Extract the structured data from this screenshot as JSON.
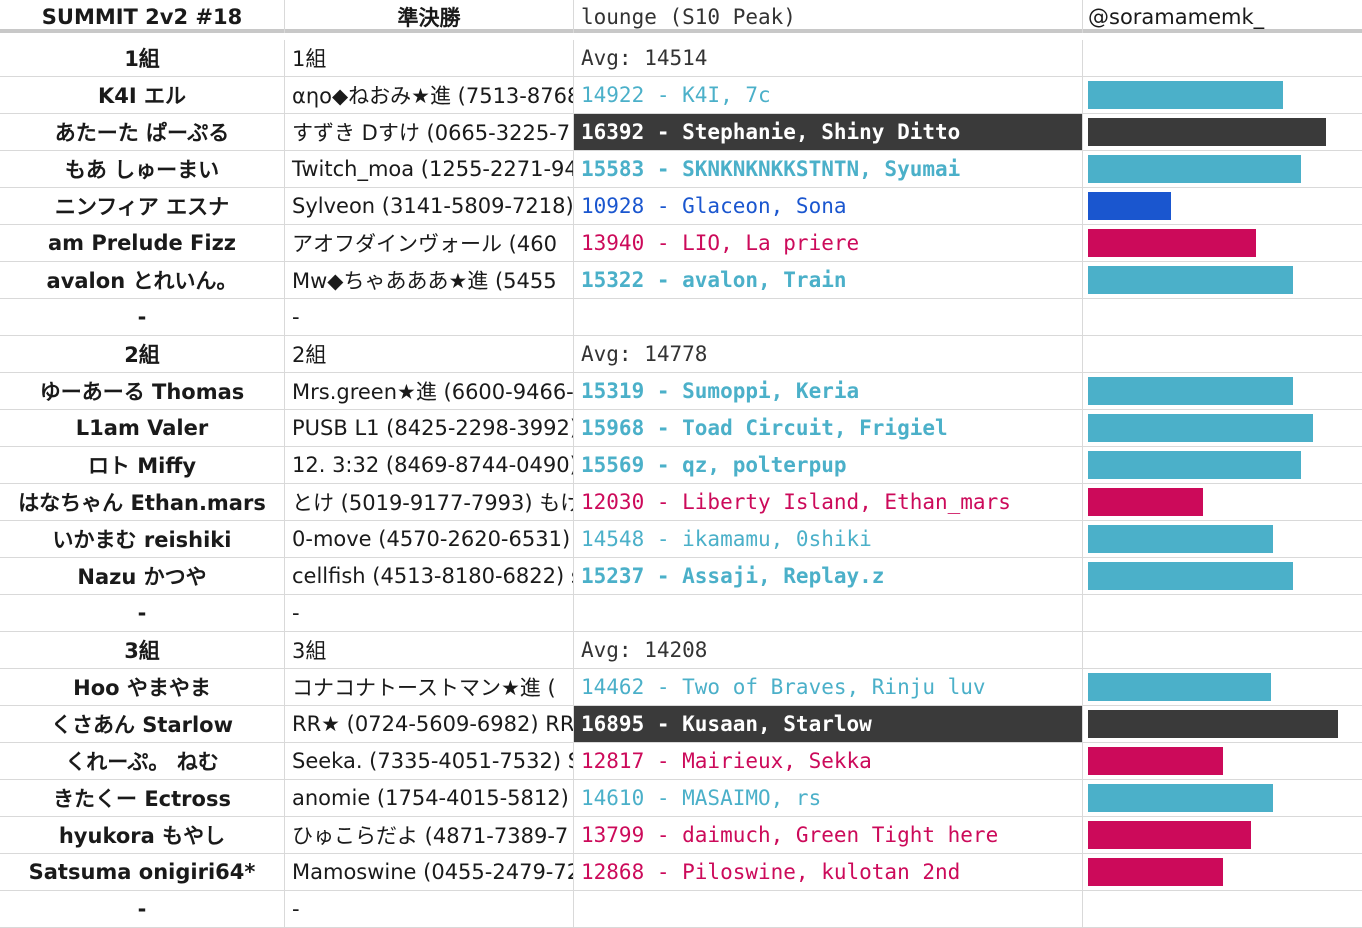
{
  "header": {
    "title": "SUMMIT 2v2 #18",
    "round": "準決勝",
    "lounge": "lounge (S10 Peak)",
    "handle": "@soramamemk_"
  },
  "colors": {
    "teal": "#4bb0c9",
    "blue": "#1a56cf",
    "pink": "#cc0a5a",
    "dark": "#3a3a3a"
  },
  "rows": [
    {
      "team": "1組",
      "detail": "1組",
      "score": "Avg: 14514",
      "kind": "avg",
      "bar": null,
      "color": "none"
    },
    {
      "team": "K4I エル",
      "detail": "αηο◆ねおみ★進 (7513-8768",
      "score": "14922 - K4I, 7c",
      "kind": "teal",
      "bar": 0.78,
      "color": "teal"
    },
    {
      "team": "あたーた ぱーぷる",
      "detail": "すずき Dすけ (0665-3225-7",
      "score": "16392 - Stephanie, Shiny Ditto",
      "kind": "dark",
      "bar": 0.95,
      "color": "dark"
    },
    {
      "team": "もあ しゅーまい",
      "detail": "Twitch_moa (1255-2271-94",
      "score": "15583 - SKNKNKNKKSTNTN, Syumai",
      "kind": "tealbold",
      "bar": 0.85,
      "color": "teal"
    },
    {
      "team": "ニンフィア エスナ",
      "detail": "Sylveon (3141-5809-7218) ",
      "score": "10928 - Glaceon, Sona",
      "kind": "blue",
      "bar": 0.33,
      "color": "blue"
    },
    {
      "team": "am Prelude Fizz",
      "detail": "アオフダインヴォール (460",
      "score": "13940 - LIO, La priere",
      "kind": "pink",
      "bar": 0.67,
      "color": "pink"
    },
    {
      "team": "avalon とれいん。",
      "detail": "Mw◆ちゃあああ★進 (5455",
      "score": "15322 - avalon, Train",
      "kind": "tealbold",
      "bar": 0.82,
      "color": "teal"
    },
    {
      "team": "-",
      "detail": "-",
      "score": "",
      "kind": "empty",
      "bar": null,
      "color": "none"
    },
    {
      "team": "2組",
      "detail": "2組",
      "score": "Avg: 14778",
      "kind": "avg",
      "bar": null,
      "color": "none"
    },
    {
      "team": "ゆーあーる Thomas",
      "detail": "Mrs.green★進 (6600-9466-",
      "score": "15319 - Sumoppi, Keria",
      "kind": "tealbold",
      "bar": 0.82,
      "color": "teal"
    },
    {
      "team": "L1am Valer",
      "detail": "PUSB L1 (8425-2298-3992) ",
      "score": "15968 - Toad Circuit, Frigiel",
      "kind": "tealbold",
      "bar": 0.9,
      "color": "teal"
    },
    {
      "team": "ロト Miffy",
      "detail": "12. 3:32 (8469-8744-0490) ",
      "score": "15569 - qz, polterpup",
      "kind": "tealbold",
      "bar": 0.85,
      "color": "teal"
    },
    {
      "team": "はなちゃん Ethan.mars",
      "detail": "とけ (5019-9177-7993) もけ",
      "score": "12030 - Liberty Island, Ethan_mars",
      "kind": "pink",
      "bar": 0.46,
      "color": "pink"
    },
    {
      "team": "いかまむ reishiki",
      "detail": "0-move (4570-2620-6531) (",
      "score": "14548 - ikamamu, 0shiki",
      "kind": "teal",
      "bar": 0.74,
      "color": "teal"
    },
    {
      "team": "Nazu かつや",
      "detail": "cellfish (4513-8180-6822) s",
      "score": "15237 - Assaji, Replay.z",
      "kind": "tealbold",
      "bar": 0.82,
      "color": "teal"
    },
    {
      "team": "-",
      "detail": "-",
      "score": "",
      "kind": "empty",
      "bar": null,
      "color": "none"
    },
    {
      "team": "3組",
      "detail": "3組",
      "score": "Avg: 14208",
      "kind": "avg",
      "bar": null,
      "color": "none"
    },
    {
      "team": "Hoo やまやま",
      "detail": "コナコナトーストマン★進 (",
      "score": "14462 - Two of Braves, Rinju luv",
      "kind": "teal",
      "bar": 0.73,
      "color": "teal"
    },
    {
      "team": "くさあん Starlow",
      "detail": "RR★ (0724-5609-6982) RR",
      "score": "16895 - Kusaan, Starlow",
      "kind": "dark",
      "bar": 1.0,
      "color": "dark"
    },
    {
      "team": "くれーぷ。 ねむ",
      "detail": "Seeka. (7335-4051-7532) S",
      "score": "12817 - Mairieux, Sekka",
      "kind": "pink",
      "bar": 0.54,
      "color": "pink"
    },
    {
      "team": "きたくー Ectross",
      "detail": "anomie (1754-4015-5812) a",
      "score": "14610 - MASAIMO, rs",
      "kind": "teal",
      "bar": 0.74,
      "color": "teal"
    },
    {
      "team": "hyukora もやし",
      "detail": "ひゅこらだよ (4871-7389-7",
      "score": "13799 - daimuch, Green Tight here",
      "kind": "pink",
      "bar": 0.65,
      "color": "pink"
    },
    {
      "team": "Satsuma onigiri64*",
      "detail": "Mamoswine (0455-2479-72",
      "score": "12868 - Piloswine, kulotan 2nd",
      "kind": "pink",
      "bar": 0.54,
      "color": "pink"
    },
    {
      "team": "-",
      "detail": "-",
      "score": "",
      "kind": "empty",
      "bar": null,
      "color": "none"
    }
  ]
}
